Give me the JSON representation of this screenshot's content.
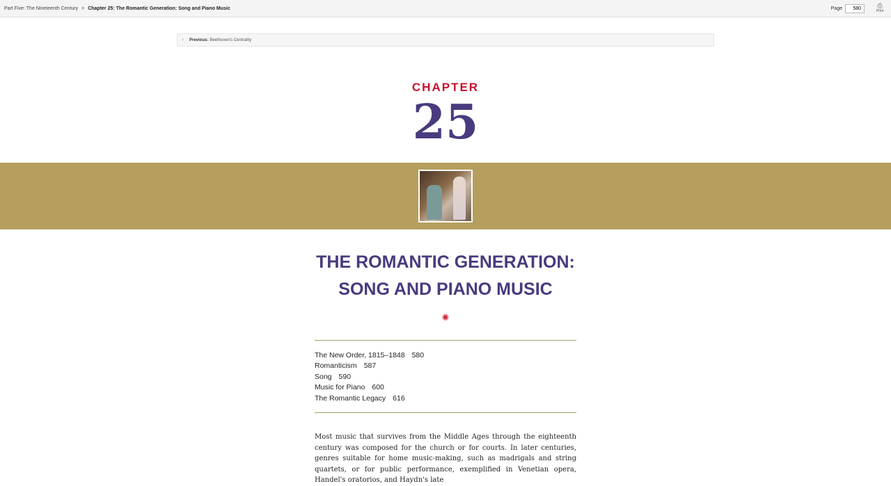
{
  "breadcrumb": {
    "part": "Part Five: The Nineteenth Century",
    "separator": ">",
    "current": "Chapter 25: The Romantic Generation: Song and Piano Music"
  },
  "page": {
    "label": "Page",
    "value": "580"
  },
  "print_label": "Print",
  "previous": {
    "label": "Previous:",
    "title": "Beethoven's Centrality"
  },
  "chapter": {
    "label": "CHAPTER",
    "number": "25"
  },
  "title": {
    "line1": "THE ROMANTIC GENERATION:",
    "line2": "SONG AND PIANO MUSIC"
  },
  "toc": [
    {
      "title": "The New Order, 1815–1848",
      "page": "580"
    },
    {
      "title": "Romanticism",
      "page": "587"
    },
    {
      "title": "Song",
      "page": "590"
    },
    {
      "title": "Music for Piano",
      "page": "600"
    },
    {
      "title": "The Romantic Legacy",
      "page": "616"
    }
  ],
  "intro": "Most music that survives from the Middle Ages through the eighteenth century was composed for the church or for courts. In later centuries, genres suitable for home music-making, such as madrigals and string quartets, or for public performance, exemplified in Venetian opera, Handel's oratorios, and Haydn's late"
}
